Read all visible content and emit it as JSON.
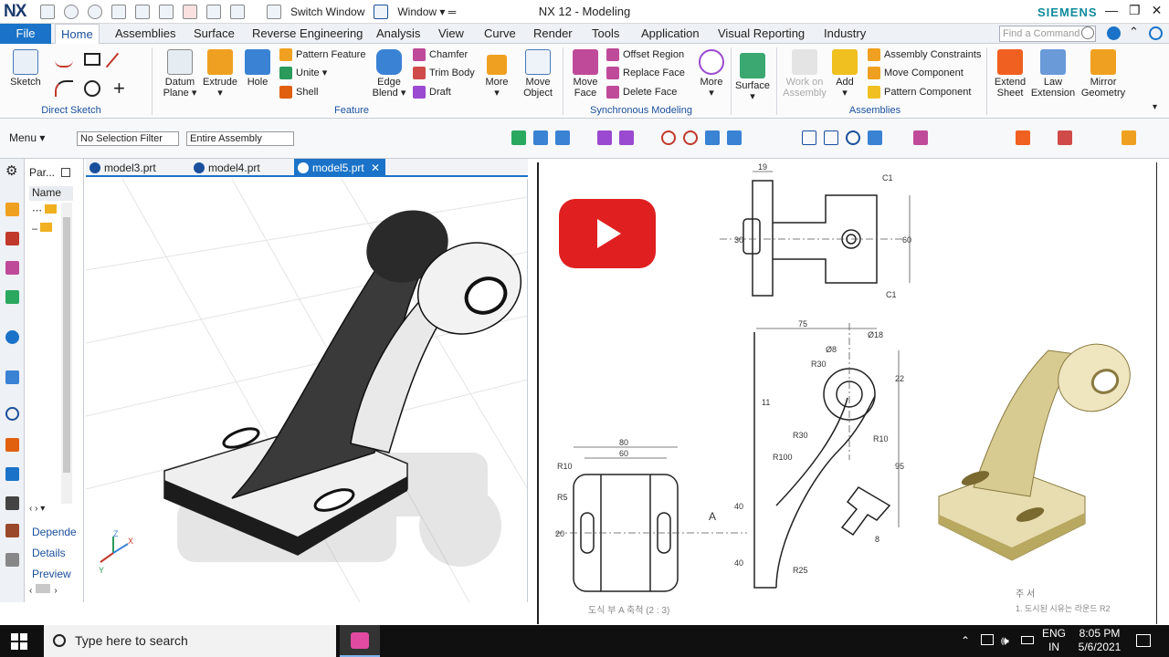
{
  "app": {
    "logo": "NX",
    "window_title": "NX 12 - Modeling",
    "brand": "SIEMENS",
    "switch_window": "Switch Window",
    "window_menu": "Window ▾ ═"
  },
  "menu_tabs": {
    "file": "File",
    "items": [
      "Home",
      "Assemblies",
      "Surface",
      "Reverse Engineering",
      "Analysis",
      "View",
      "Curve",
      "Render",
      "Tools",
      "Application",
      "Visual Reporting",
      "Industry"
    ],
    "active": "Home",
    "command_finder_placeholder": "Find a Command"
  },
  "ribbon": {
    "direct_sketch": {
      "label": "Direct Sketch",
      "sketch": "Sketch"
    },
    "feature": {
      "label": "Feature",
      "datum_plane": "Datum\nPlane ▾",
      "extrude": "Extrude\n▾",
      "hole": "Hole",
      "pattern_feature": "Pattern Feature",
      "unite": "Unite ▾",
      "shell": "Shell",
      "edge_blend": "Edge\nBlend ▾",
      "chamfer": "Chamfer",
      "trim_body": "Trim Body",
      "draft": "Draft",
      "more": "More\n▾",
      "move_object": "Move\nObject"
    },
    "synchronous": {
      "label": "Synchronous Modeling",
      "move_face": "Move\nFace",
      "offset_region": "Offset Region",
      "replace_face": "Replace Face",
      "delete_face": "Delete Face",
      "more": "More\n▾"
    },
    "surface": "Surface\n▾",
    "assemblies": {
      "label": "Assemblies",
      "work_on_assembly": "Work on\nAssembly",
      "add": "Add\n▾",
      "assembly_constraints": "Assembly Constraints",
      "move_component": "Move Component",
      "pattern_component": "Pattern Component"
    },
    "extend_sheet": "Extend\nSheet",
    "law_extension": "Law\nExtension",
    "mirror_geometry": "Mirror\nGeometry"
  },
  "toolbar": {
    "menu": "Menu ▾",
    "selection_filter": "No Selection Filter",
    "scope": "Entire Assembly"
  },
  "navigator": {
    "header": "Par...",
    "column": "Name",
    "links": [
      "Depende",
      "Details",
      "Preview"
    ]
  },
  "doc_tabs": [
    "model3.prt",
    "model4.prt",
    "model5.prt"
  ],
  "active_doc": "model5.prt",
  "drawing": {
    "dims_top": [
      "19",
      "30",
      "60",
      "C1",
      "C1"
    ],
    "dims_front": [
      "75",
      "Ø18",
      "Ø8",
      "R30",
      "R30",
      "R10",
      "R100",
      "22",
      "95",
      "11",
      "R25",
      "8",
      "40",
      "40"
    ],
    "dims_left": [
      "80",
      "60",
      "R10",
      "R5",
      "20"
    ],
    "section_marker": "A",
    "scale_note": "도식 부 A 축척 (2 : 3)",
    "note_title": "주  서",
    "note_line": "1. 도시된 시유는 라운드 R2"
  },
  "colors": {
    "accent": "#1a73c8",
    "youtube_red": "#e02020",
    "brand_teal": "#0f8b9c",
    "part_tan": "#e8ddb0"
  },
  "taskbar": {
    "search_placeholder": "Type here to search",
    "language": "ENG",
    "region": "IN",
    "time": "8:05 PM",
    "date": "5/6/2021"
  }
}
